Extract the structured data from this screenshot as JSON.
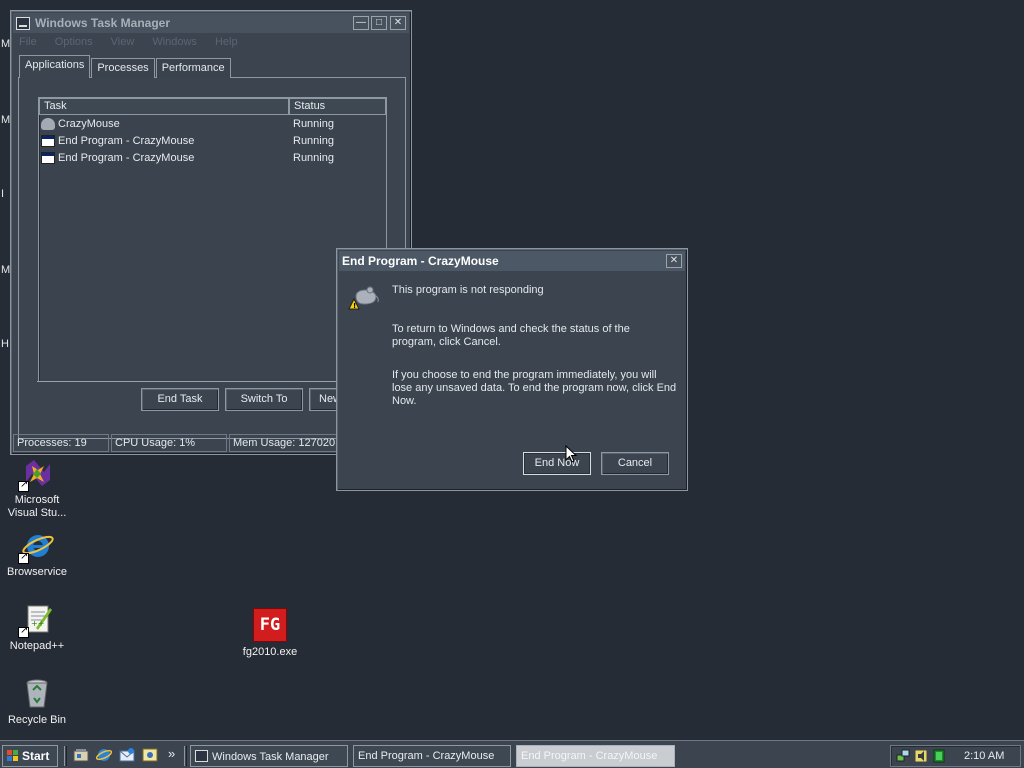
{
  "desktop": {
    "edge_letters": [
      "M",
      "M",
      "I",
      "M",
      "H"
    ],
    "icons": [
      {
        "label": "Microsoft Visual Stu...",
        "icon": "visual-studio-icon"
      },
      {
        "label": "Browservice",
        "icon": "internet-explorer-icon"
      },
      {
        "label": "Notepad++",
        "icon": "notepad-plus-plus-icon"
      },
      {
        "label": "Recycle Bin",
        "icon": "recycle-bin-icon"
      },
      {
        "label": "fg2010.exe",
        "icon": "fg-app-icon",
        "glyph_text": "FG"
      }
    ]
  },
  "task_manager": {
    "title": "Windows Task Manager",
    "menu": [
      "File",
      "Options",
      "View",
      "Windows",
      "Help"
    ],
    "tabs": [
      "Applications",
      "Processes",
      "Performance"
    ],
    "selected_tab": "Applications",
    "columns": {
      "task": "Task",
      "status": "Status"
    },
    "rows": [
      {
        "task": "CrazyMouse",
        "status": "Running",
        "icon": "mouse-icon"
      },
      {
        "task": "End Program - CrazyMouse",
        "status": "Running",
        "icon": "window-icon"
      },
      {
        "task": "End Program - CrazyMouse",
        "status": "Running",
        "icon": "window-icon"
      }
    ],
    "buttons": {
      "end_task": "End Task",
      "switch_to": "Switch To",
      "new_task": "New Task..."
    },
    "status": {
      "processes": "Processes: 19",
      "cpu": "CPU Usage: 1%",
      "mem": "Mem Usage: 127020K / 1247776K"
    }
  },
  "dialog": {
    "title": "End Program - CrazyMouse",
    "line1": "This program is not responding",
    "line2": "To return to Windows and check the status of the program, click Cancel.",
    "line3": "If you choose to end the program immediately, you will lose any unsaved data. To end the program now, click End Now.",
    "end_now": "End Now",
    "cancel": "Cancel"
  },
  "taskbar": {
    "start": "Start",
    "quick_launch": [
      "show-desktop-icon",
      "internet-explorer-icon",
      "outlook-express-icon",
      "windows-media-icon"
    ],
    "overflow": "»",
    "tasks": [
      {
        "label": "Windows Task Manager",
        "active": false
      },
      {
        "label": "End Program - CrazyMouse",
        "active": false
      },
      {
        "label": "End Program - CrazyMouse",
        "active": true
      }
    ],
    "clock": "2:10 AM"
  }
}
